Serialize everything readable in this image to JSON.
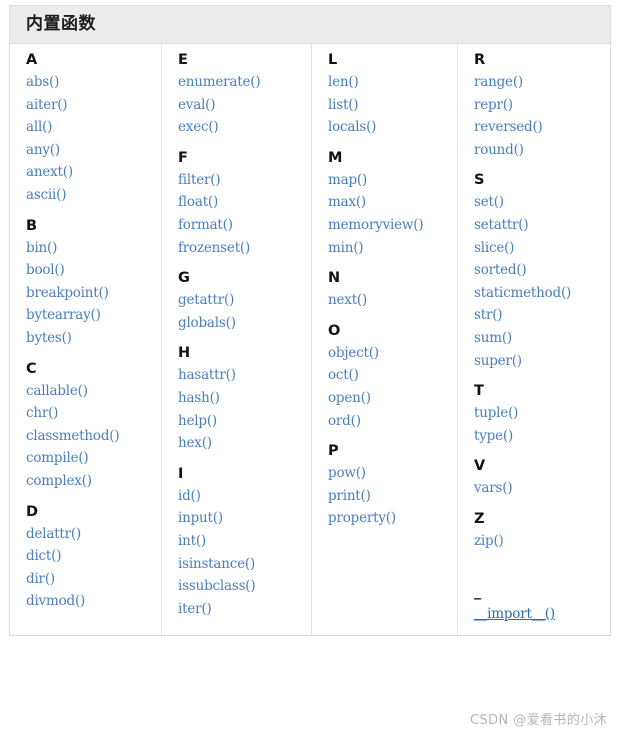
{
  "table": {
    "caption": "内置函数",
    "columns": [
      {
        "groups": [
          {
            "letter": "A",
            "functions": [
              "abs()",
              "aiter()",
              "all()",
              "any()",
              "anext()",
              "ascii()"
            ]
          },
          {
            "letter": "B",
            "functions": [
              "bin()",
              "bool()",
              "breakpoint()",
              "bytearray()",
              "bytes()"
            ]
          },
          {
            "letter": "C",
            "functions": [
              "callable()",
              "chr()",
              "classmethod()",
              "compile()",
              "complex()"
            ]
          },
          {
            "letter": "D",
            "functions": [
              "delattr()",
              "dict()",
              "dir()",
              "divmod()"
            ]
          }
        ]
      },
      {
        "groups": [
          {
            "letter": "E",
            "functions": [
              "enumerate()",
              "eval()",
              "exec()"
            ]
          },
          {
            "letter": "F",
            "functions": [
              "filter()",
              "float()",
              "format()",
              "frozenset()"
            ]
          },
          {
            "letter": "G",
            "functions": [
              "getattr()",
              "globals()"
            ]
          },
          {
            "letter": "H",
            "functions": [
              "hasattr()",
              "hash()",
              "help()",
              "hex()"
            ]
          },
          {
            "letter": "I",
            "functions": [
              "id()",
              "input()",
              "int()",
              "isinstance()",
              "issubclass()",
              "iter()"
            ]
          }
        ]
      },
      {
        "groups": [
          {
            "letter": "L",
            "functions": [
              "len()",
              "list()",
              "locals()"
            ]
          },
          {
            "letter": "M",
            "functions": [
              "map()",
              "max()",
              "memoryview()",
              "min()"
            ]
          },
          {
            "letter": "N",
            "functions": [
              "next()"
            ]
          },
          {
            "letter": "O",
            "functions": [
              "object()",
              "oct()",
              "open()",
              "ord()"
            ]
          },
          {
            "letter": "P",
            "functions": [
              "pow()",
              "print()",
              "property()"
            ]
          }
        ]
      },
      {
        "groups": [
          {
            "letter": "R",
            "functions": [
              "range()",
              "repr()",
              "reversed()",
              "round()"
            ]
          },
          {
            "letter": "S",
            "functions": [
              "set()",
              "setattr()",
              "slice()",
              "sorted()",
              "staticmethod()",
              "str()",
              "sum()",
              "super()"
            ]
          },
          {
            "letter": "T",
            "functions": [
              "tuple()",
              "type()"
            ]
          },
          {
            "letter": "V",
            "functions": [
              "vars()"
            ]
          },
          {
            "letter": "Z",
            "functions": [
              "zip()"
            ]
          },
          {
            "letter": "_",
            "functions": [
              "__import__()"
            ],
            "linked": true,
            "spacer_before": true
          }
        ]
      }
    ]
  },
  "watermark": {
    "text": "CSDN @爱看书的小沐"
  },
  "colors": {
    "caption_background": "#ececec",
    "link": "#4a7ebb",
    "border": "#dcdcdc",
    "letter": "#121212",
    "watermark": "#b6b6b6"
  }
}
